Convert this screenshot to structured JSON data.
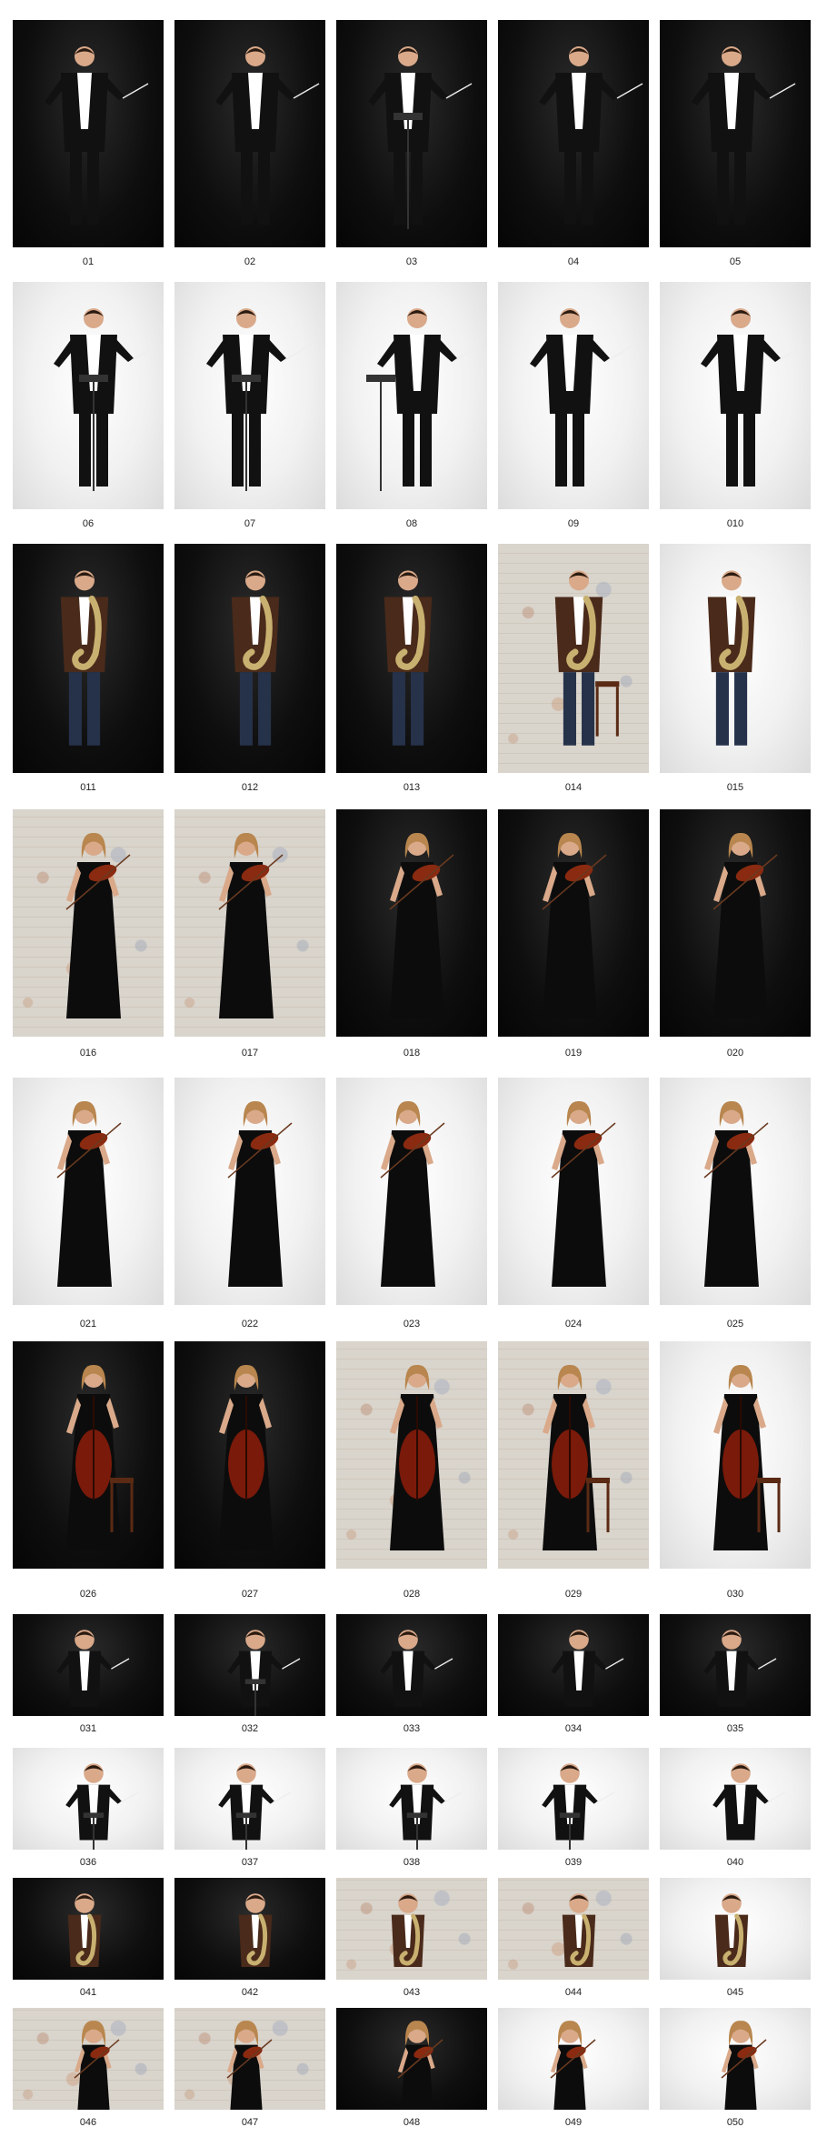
{
  "colors": {
    "dark_bg": "#0a0a0a",
    "light_bg": "#eeeeee",
    "caption_text": "#222222",
    "suit": "#111111",
    "shirt": "#ffffff",
    "dress": "#0c0c0c",
    "skin": "#d9a98a",
    "hair_dark": "#2a1a10",
    "hair_blonde": "#b8864e",
    "brown_jacket": "#4a2a1a",
    "jeans": "#26324a",
    "violin": "#8a2a10",
    "cello": "#7a1a0a",
    "sax": "#c8b070"
  },
  "rows": [
    {
      "items": [
        {
          "label": "01",
          "bg": "dark",
          "subject": "conductor",
          "prop": "none"
        },
        {
          "label": "02",
          "bg": "dark",
          "subject": "conductor",
          "prop": "none"
        },
        {
          "label": "03",
          "bg": "dark",
          "subject": "conductor",
          "prop": "stand"
        },
        {
          "label": "04",
          "bg": "dark",
          "subject": "conductor",
          "prop": "none"
        },
        {
          "label": "05",
          "bg": "dark",
          "subject": "conductor",
          "prop": "none"
        }
      ]
    },
    {
      "items": [
        {
          "label": "06",
          "bg": "light",
          "subject": "conductor",
          "prop": "stand"
        },
        {
          "label": "07",
          "bg": "light",
          "subject": "conductor",
          "prop": "stand"
        },
        {
          "label": "08",
          "bg": "light",
          "subject": "conductor",
          "prop": "stand-side"
        },
        {
          "label": "09",
          "bg": "light",
          "subject": "conductor",
          "prop": "none"
        },
        {
          "label": "010",
          "bg": "light",
          "subject": "conductor",
          "prop": "none"
        }
      ]
    },
    {
      "items": [
        {
          "label": "011",
          "bg": "dark",
          "subject": "sax",
          "prop": "none"
        },
        {
          "label": "012",
          "bg": "dark",
          "subject": "sax",
          "prop": "none"
        },
        {
          "label": "013",
          "bg": "dark",
          "subject": "sax",
          "prop": "none"
        },
        {
          "label": "014",
          "bg": "wall",
          "subject": "sax",
          "prop": "stool"
        },
        {
          "label": "015",
          "bg": "light",
          "subject": "sax",
          "prop": "none"
        }
      ]
    },
    {
      "items": [
        {
          "label": "016",
          "bg": "wall",
          "subject": "violin",
          "prop": "none"
        },
        {
          "label": "017",
          "bg": "wall",
          "subject": "violin",
          "prop": "none"
        },
        {
          "label": "018",
          "bg": "dark",
          "subject": "violin",
          "prop": "none"
        },
        {
          "label": "019",
          "bg": "dark",
          "subject": "violin",
          "prop": "none"
        },
        {
          "label": "020",
          "bg": "dark",
          "subject": "violin",
          "prop": "none"
        }
      ]
    },
    {
      "items": [
        {
          "label": "021",
          "bg": "light",
          "subject": "violin",
          "prop": "none"
        },
        {
          "label": "022",
          "bg": "light",
          "subject": "violin",
          "prop": "none"
        },
        {
          "label": "023",
          "bg": "light",
          "subject": "violin",
          "prop": "none"
        },
        {
          "label": "024",
          "bg": "light",
          "subject": "violin",
          "prop": "none"
        },
        {
          "label": "025",
          "bg": "light",
          "subject": "violin",
          "prop": "none"
        }
      ]
    },
    {
      "items": [
        {
          "label": "026",
          "bg": "dark",
          "subject": "cello",
          "prop": "chair"
        },
        {
          "label": "027",
          "bg": "dark",
          "subject": "cello",
          "prop": "none"
        },
        {
          "label": "028",
          "bg": "wall",
          "subject": "cello",
          "prop": "none"
        },
        {
          "label": "029",
          "bg": "wall",
          "subject": "cello",
          "prop": "chair"
        },
        {
          "label": "030",
          "bg": "light",
          "subject": "cello",
          "prop": "chair"
        }
      ]
    },
    {
      "items": [
        {
          "label": "031",
          "bg": "dark",
          "subject": "conductor",
          "prop": "none"
        },
        {
          "label": "032",
          "bg": "dark",
          "subject": "conductor",
          "prop": "stand"
        },
        {
          "label": "033",
          "bg": "dark",
          "subject": "conductor",
          "prop": "none"
        },
        {
          "label": "034",
          "bg": "dark",
          "subject": "conductor",
          "prop": "none"
        },
        {
          "label": "035",
          "bg": "dark",
          "subject": "conductor",
          "prop": "none"
        }
      ]
    },
    {
      "items": [
        {
          "label": "036",
          "bg": "light",
          "subject": "conductor",
          "prop": "stand"
        },
        {
          "label": "037",
          "bg": "light",
          "subject": "conductor",
          "prop": "stand"
        },
        {
          "label": "038",
          "bg": "light",
          "subject": "conductor",
          "prop": "stand"
        },
        {
          "label": "039",
          "bg": "light",
          "subject": "conductor",
          "prop": "stand"
        },
        {
          "label": "040",
          "bg": "light",
          "subject": "conductor",
          "prop": "none"
        }
      ]
    },
    {
      "items": [
        {
          "label": "041",
          "bg": "dark",
          "subject": "sax",
          "prop": "none"
        },
        {
          "label": "042",
          "bg": "dark",
          "subject": "sax",
          "prop": "none"
        },
        {
          "label": "043",
          "bg": "wall",
          "subject": "sax",
          "prop": "none"
        },
        {
          "label": "044",
          "bg": "wall",
          "subject": "sax",
          "prop": "none"
        },
        {
          "label": "045",
          "bg": "light",
          "subject": "sax",
          "prop": "none"
        }
      ]
    },
    {
      "items": [
        {
          "label": "046",
          "bg": "wall",
          "subject": "violin",
          "prop": "none"
        },
        {
          "label": "047",
          "bg": "wall",
          "subject": "violin",
          "prop": "none"
        },
        {
          "label": "048",
          "bg": "dark",
          "subject": "violin",
          "prop": "none"
        },
        {
          "label": "049",
          "bg": "light",
          "subject": "violin",
          "prop": "none"
        },
        {
          "label": "050",
          "bg": "light",
          "subject": "violin",
          "prop": "none"
        }
      ]
    }
  ]
}
